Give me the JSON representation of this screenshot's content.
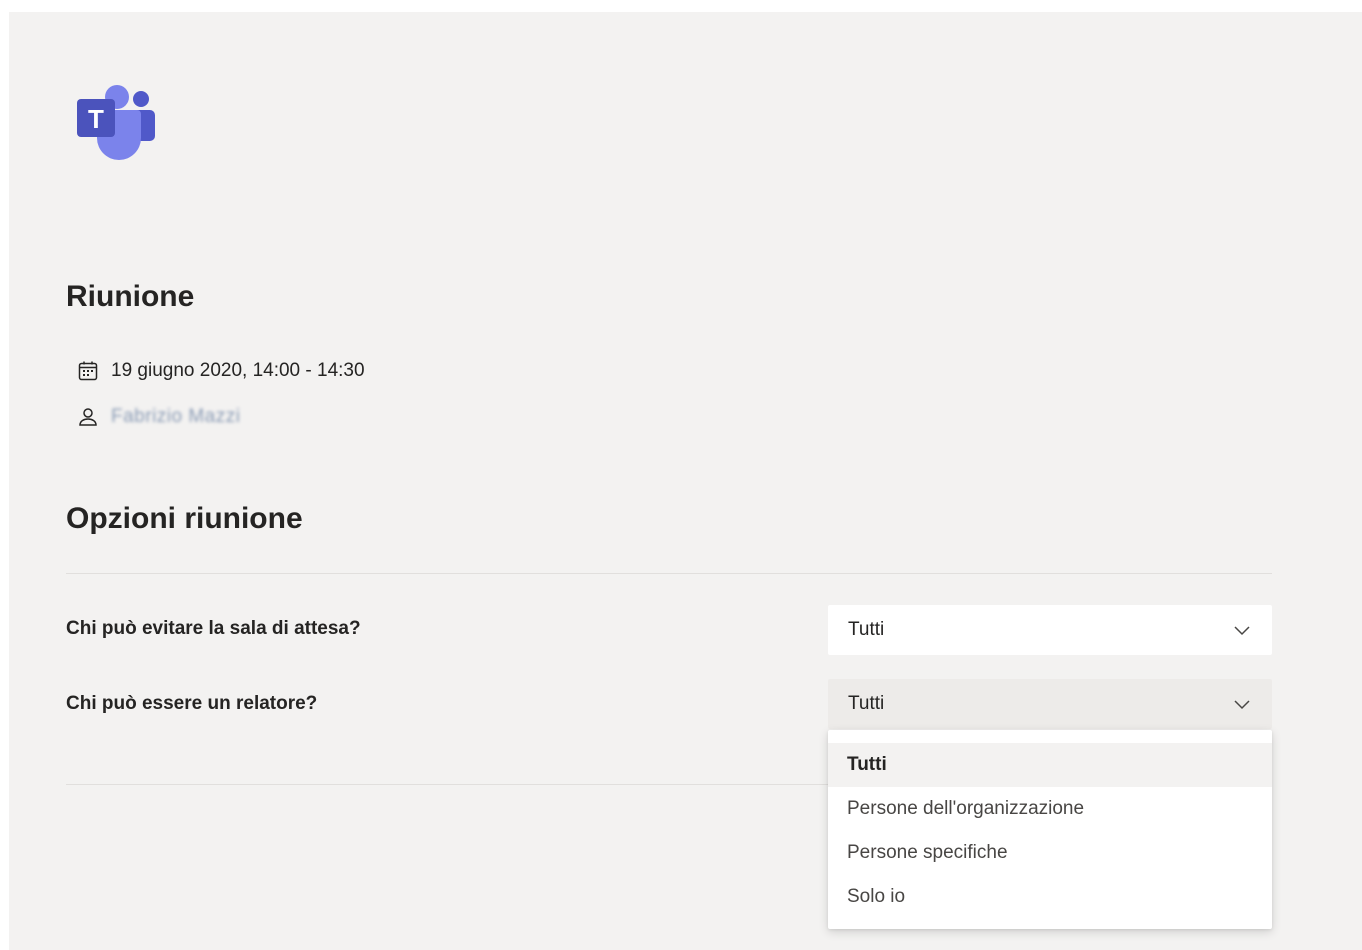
{
  "app": {
    "logo_letter": "T"
  },
  "meeting": {
    "title": "Riunione",
    "datetime": "19 giugno 2020, 14:00 - 14:30",
    "organizer": "Fabrizio Mazzi"
  },
  "options": {
    "title": "Opzioni riunione",
    "lobby": {
      "label": "Chi può evitare la sala di attesa?",
      "value": "Tutti"
    },
    "presenter": {
      "label": "Chi può essere un relatore?",
      "value": "Tutti"
    }
  },
  "dropdown": {
    "items": [
      {
        "label": "Tutti"
      },
      {
        "label": "Persone dell'organizzazione"
      },
      {
        "label": "Persone specifiche"
      },
      {
        "label": "Solo io"
      }
    ]
  },
  "colors": {
    "page_bg": "#f3f2f1",
    "teams_purple": "#5059c9",
    "teams_purple_light": "#7b83eb"
  },
  "icons": {
    "logo": "teams-logo-icon",
    "date": "calendar-icon",
    "organizer": "person-icon",
    "select": "chevron-down-icon"
  }
}
